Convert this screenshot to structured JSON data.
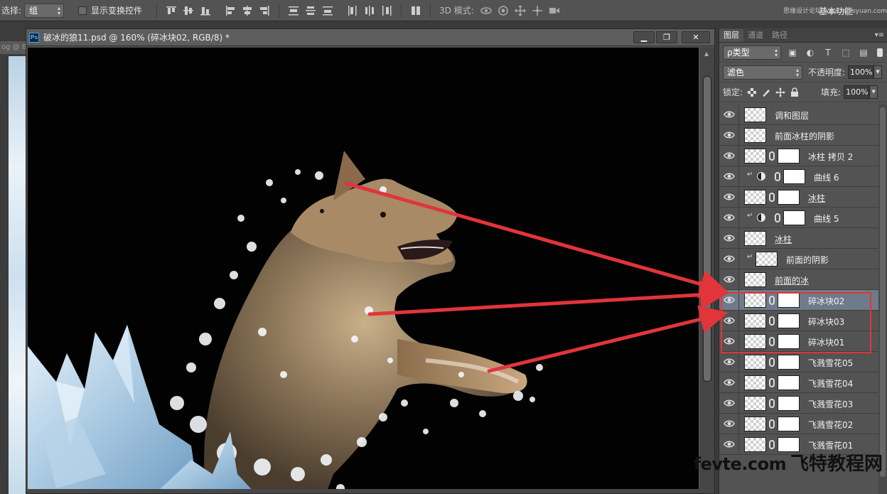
{
  "options_bar": {
    "select_label": "选择:",
    "select_value": "组",
    "transform_label": "显示变换控件",
    "mode3d_label": "3D 模式:",
    "workspace": "基本功能",
    "top_watermark": "思缘设计论坛 www.missyuan.com"
  },
  "left_strip": {
    "tab_text": "og @ 8"
  },
  "document": {
    "title": "破冰的狼11.psd @ 160% (碎冰块02, RGB/8) *",
    "ps_badge": "Ps",
    "minimize_label": "▁",
    "restore_label": "❐",
    "close_label": "✕"
  },
  "layers_panel": {
    "tabs": [
      {
        "label": "图层",
        "active": true
      },
      {
        "label": "通道",
        "active": false
      },
      {
        "label": "路径",
        "active": false
      }
    ],
    "filter_kind": "ρ类型",
    "blend_mode": "滤色",
    "opacity_label": "不透明度:",
    "opacity_value": "100%",
    "lock_label": "锁定:",
    "fill_label": "填充:",
    "fill_value": "100%",
    "layers": [
      {
        "name": "调和图层",
        "thumb": "checker",
        "mask": false,
        "adjustment": false,
        "clipped": false,
        "underline": false,
        "selected": false
      },
      {
        "name": "前面冰柱的阴影",
        "thumb": "checker",
        "mask": false,
        "adjustment": false,
        "clipped": false,
        "underline": false,
        "selected": false
      },
      {
        "name": "冰柱 拷贝 2",
        "thumb": "checker",
        "mask": true,
        "adjustment": false,
        "clipped": false,
        "underline": false,
        "selected": false
      },
      {
        "name": "曲线 6",
        "thumb": "none",
        "mask": true,
        "adjustment": true,
        "clipped": true,
        "underline": false,
        "selected": false
      },
      {
        "name": "冰柱",
        "thumb": "checker",
        "mask": true,
        "adjustment": false,
        "clipped": false,
        "underline": true,
        "selected": false
      },
      {
        "name": "曲线 5",
        "thumb": "none",
        "mask": true,
        "adjustment": true,
        "clipped": true,
        "underline": false,
        "selected": false
      },
      {
        "name": "冰柱",
        "thumb": "checker",
        "mask": false,
        "adjustment": false,
        "clipped": false,
        "underline": true,
        "selected": false
      },
      {
        "name": "前面的阴影",
        "thumb": "checker",
        "mask": false,
        "adjustment": false,
        "clipped": true,
        "underline": false,
        "selected": false
      },
      {
        "name": "前面的冰",
        "thumb": "checker",
        "mask": false,
        "adjustment": false,
        "clipped": false,
        "underline": true,
        "selected": false
      },
      {
        "name": "碎冰块02",
        "thumb": "checker",
        "mask": true,
        "adjustment": false,
        "clipped": false,
        "underline": false,
        "selected": true
      },
      {
        "name": "碎冰块03",
        "thumb": "checker",
        "mask": true,
        "adjustment": false,
        "clipped": false,
        "underline": false,
        "selected": false
      },
      {
        "name": "碎冰块01",
        "thumb": "checker",
        "mask": true,
        "adjustment": false,
        "clipped": false,
        "underline": false,
        "selected": false
      },
      {
        "name": "飞溅雪花05",
        "thumb": "checker",
        "mask": true,
        "adjustment": false,
        "clipped": false,
        "underline": false,
        "selected": false
      },
      {
        "name": "飞溅雪花04",
        "thumb": "checker",
        "mask": true,
        "adjustment": false,
        "clipped": false,
        "underline": false,
        "selected": false
      },
      {
        "name": "飞溅雪花03",
        "thumb": "checker",
        "mask": true,
        "adjustment": false,
        "clipped": false,
        "underline": false,
        "selected": false
      },
      {
        "name": "飞溅雪花02",
        "thumb": "checker",
        "mask": true,
        "adjustment": false,
        "clipped": false,
        "underline": false,
        "selected": false
      },
      {
        "name": "飞溅雪花01",
        "thumb": "checker",
        "mask": true,
        "adjustment": false,
        "clipped": false,
        "underline": false,
        "selected": false
      }
    ]
  },
  "site_logo": {
    "latin": "fevte.com",
    "cn": "飞特教程网"
  },
  "colors": {
    "annotation_red": "#e2343b",
    "selected_layer": "#6f7b8a",
    "panel_bg": "#535353"
  }
}
